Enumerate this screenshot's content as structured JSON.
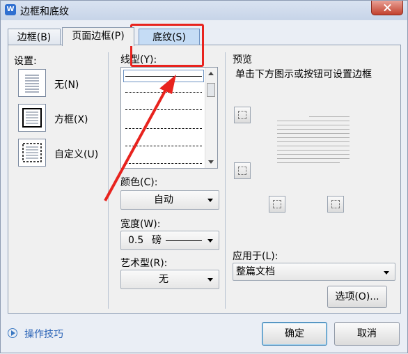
{
  "window": {
    "title": "边框和底纹",
    "app_icon_letter": "W"
  },
  "tabs": [
    {
      "label": "边框(B)"
    },
    {
      "label": "页面边框(P)"
    },
    {
      "label": "底纹(S)"
    }
  ],
  "settings": {
    "heading": "设置:",
    "options": [
      {
        "label": "无(N)",
        "icon": "no-border-icon"
      },
      {
        "label": "方框(X)",
        "icon": "box-border-icon"
      },
      {
        "label": "自定义(U)",
        "icon": "custom-border-icon"
      }
    ]
  },
  "line_style": {
    "heading": "线型(Y):"
  },
  "color": {
    "label": "颜色(C):",
    "value": "自动"
  },
  "width": {
    "label": "宽度(W):",
    "value": "0.5",
    "unit": "磅"
  },
  "art": {
    "label": "艺术型(R):",
    "value": "无"
  },
  "preview": {
    "heading": "预览",
    "hint": "单击下方图示或按钮可设置边框"
  },
  "apply_to": {
    "label": "应用于(L):",
    "value": "整篇文档"
  },
  "buttons": {
    "options": "选项(O)...",
    "ok": "确定",
    "cancel": "取消"
  },
  "tips": {
    "label": "操作技巧"
  },
  "colors": {
    "accent_red": "#e8231e",
    "tab_selected": "#c5dcf5"
  }
}
